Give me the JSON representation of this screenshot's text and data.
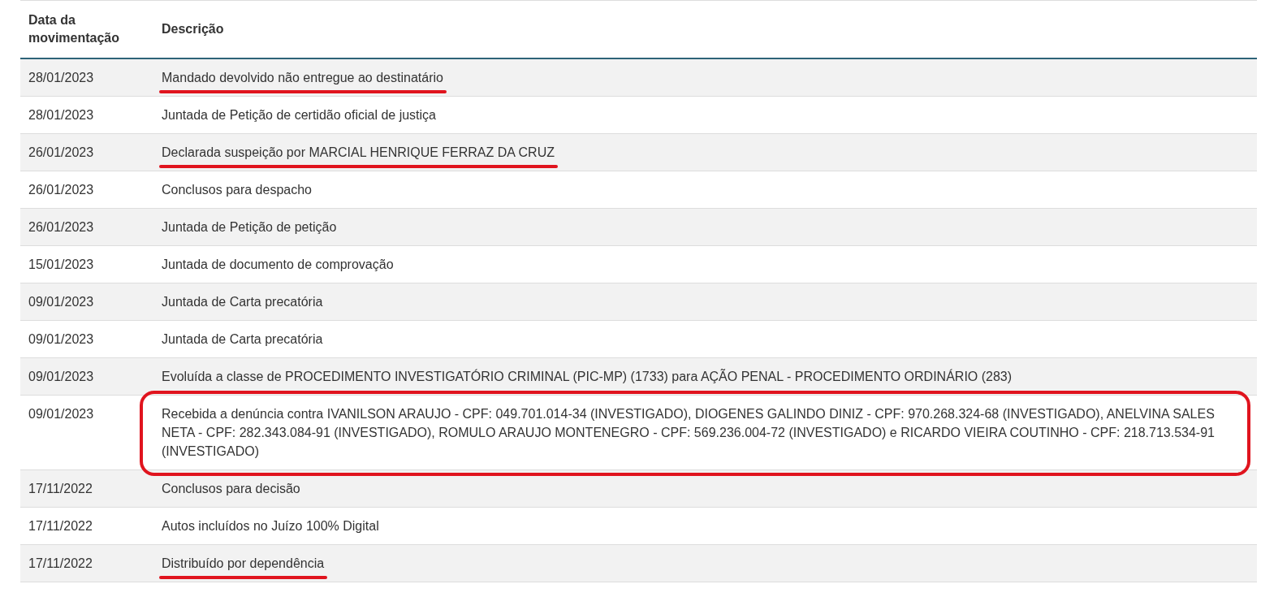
{
  "table": {
    "columns": [
      "Data da movimentação",
      "Descrição"
    ],
    "rows": [
      {
        "date": "28/01/2023",
        "description": "Mandado devolvido não entregue ao destinatário",
        "underlined": true,
        "boxed": false
      },
      {
        "date": "28/01/2023",
        "description": "Juntada de Petição de certidão oficial de justiça",
        "underlined": false,
        "boxed": false
      },
      {
        "date": "26/01/2023",
        "description": "Declarada suspeição por MARCIAL HENRIQUE FERRAZ DA CRUZ",
        "underlined": true,
        "boxed": false
      },
      {
        "date": "26/01/2023",
        "description": "Conclusos para despacho",
        "underlined": false,
        "boxed": false
      },
      {
        "date": "26/01/2023",
        "description": "Juntada de Petição de petição",
        "underlined": false,
        "boxed": false
      },
      {
        "date": "15/01/2023",
        "description": "Juntada de documento de comprovação",
        "underlined": false,
        "boxed": false
      },
      {
        "date": "09/01/2023",
        "description": "Juntada de Carta precatória",
        "underlined": false,
        "boxed": false
      },
      {
        "date": "09/01/2023",
        "description": "Juntada de Carta precatória",
        "underlined": false,
        "boxed": false
      },
      {
        "date": "09/01/2023",
        "description": "Evoluída a classe de PROCEDIMENTO INVESTIGATÓRIO CRIMINAL (PIC-MP) (1733) para AÇÃO PENAL - PROCEDIMENTO ORDINÁRIO (283)",
        "underlined": false,
        "boxed": false
      },
      {
        "date": "09/01/2023",
        "description": "Recebida a denúncia contra IVANILSON ARAUJO - CPF: 049.701.014-34 (INVESTIGADO), DIOGENES GALINDO DINIZ - CPF: 970.268.324-68 (INVESTIGADO), ANELVINA SALES NETA - CPF: 282.343.084-91 (INVESTIGADO), ROMULO ARAUJO MONTENEGRO - CPF: 569.236.004-72 (INVESTIGADO) e RICARDO VIEIRA COUTINHO - CPF: 218.713.534-91 (INVESTIGADO)",
        "underlined": false,
        "boxed": true
      },
      {
        "date": "17/11/2022",
        "description": "Conclusos para decisão",
        "underlined": false,
        "boxed": false
      },
      {
        "date": "17/11/2022",
        "description": "Autos incluídos no Juízo 100% Digital",
        "underlined": false,
        "boxed": false
      },
      {
        "date": "17/11/2022",
        "description": "Distribuído por dependência",
        "underlined": true,
        "boxed": false
      }
    ]
  }
}
